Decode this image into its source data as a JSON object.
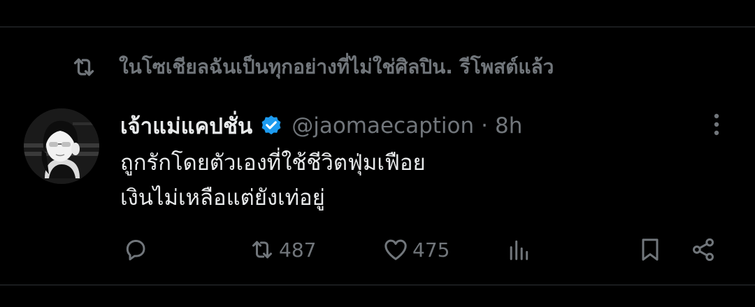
{
  "context": {
    "retweet_text": "ในโซเชียลฉันเป็นทุกอย่างที่ไม่ใช่ศิลปิน. รีโพสต์แล้ว"
  },
  "tweet": {
    "display_name": "เจ้าแม่แคปชั่น",
    "handle": "@jaomaecaption",
    "separator": "·",
    "time": "8h",
    "text_lines": [
      "ถูกรักโดยตัวเองที่ใช้ชีวิตฟุ่มเฟือย",
      "เงินไม่เหลือแต่ยังเท่อยู่"
    ],
    "verified_color": "#1d9bf0"
  },
  "actions": {
    "reply_count": "",
    "repost_count": "487",
    "like_count": "475"
  },
  "colors": {
    "background": "#000000",
    "primary_text": "#e7e9ea",
    "secondary_text": "#71767b",
    "divider": "#2f3336",
    "accent": "#1d9bf0"
  }
}
